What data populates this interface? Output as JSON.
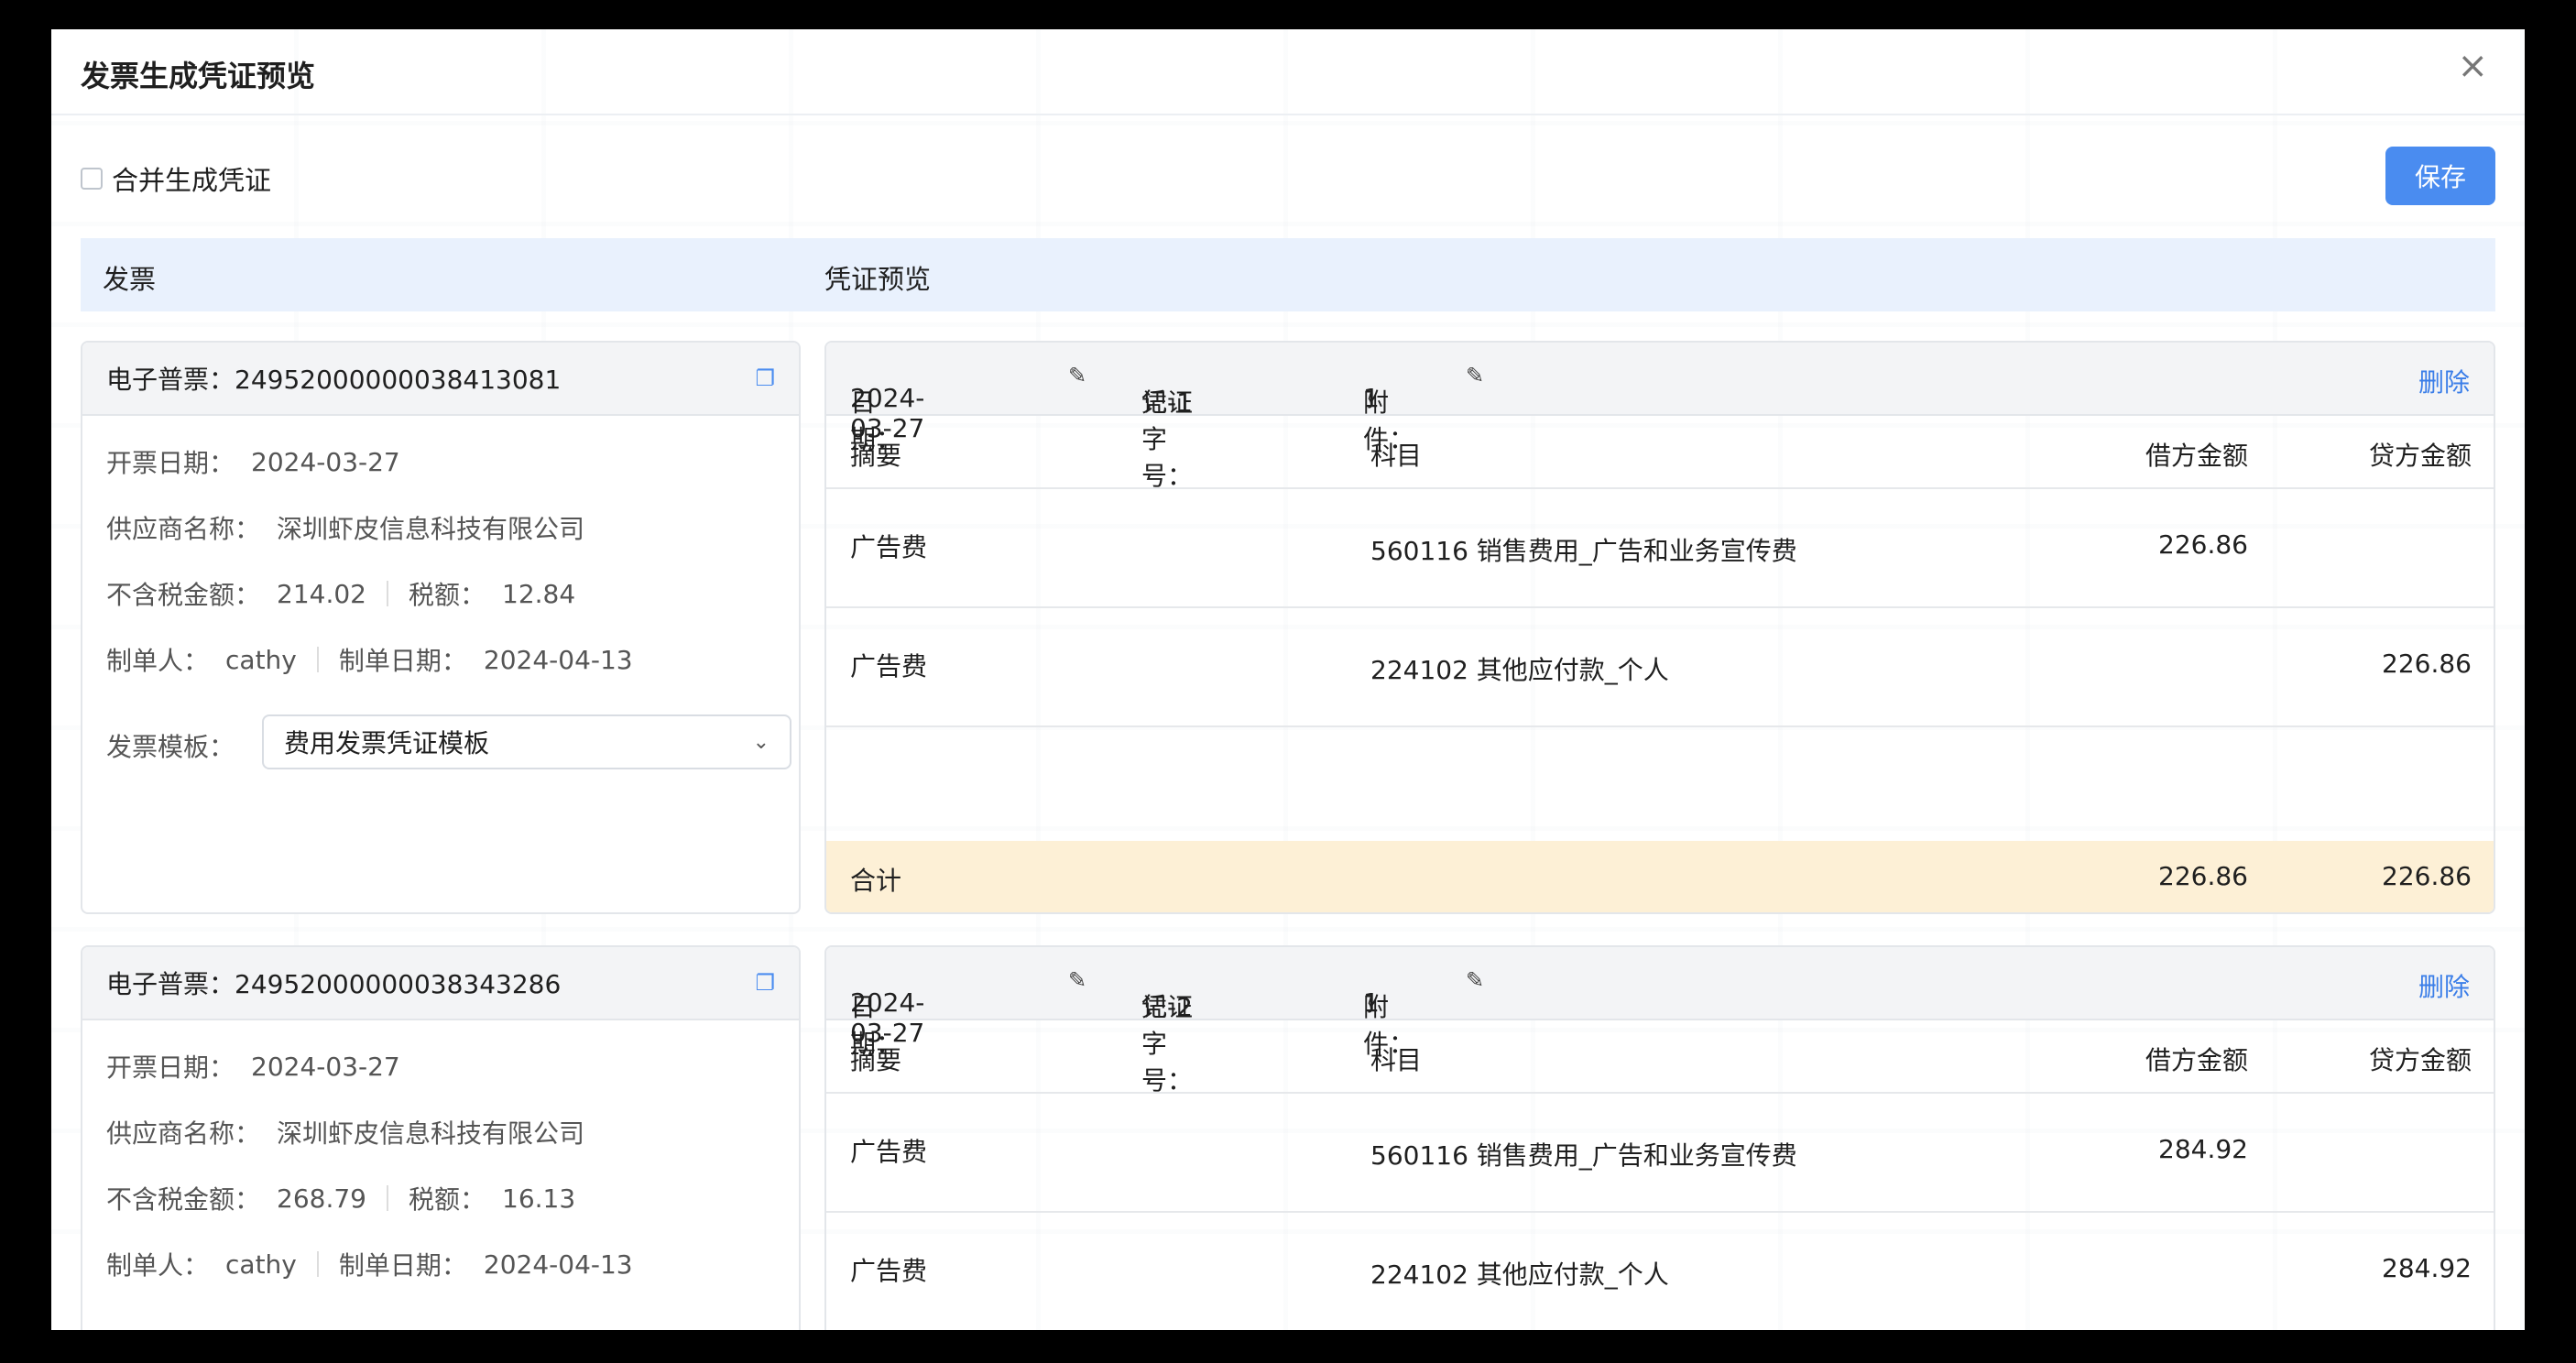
{
  "dialog": {
    "title": "发票生成凭证预览",
    "close": "×"
  },
  "toolbar": {
    "merge_label": "合并生成凭证",
    "save_label": "保存"
  },
  "columns": {
    "invoice": "发票",
    "voucher": "凭证预览"
  },
  "labels": {
    "invoice_prefix": "电子普票：",
    "issue_date": "开票日期：",
    "supplier": "供应商名称：",
    "amount_ex_tax": "不含税金额：",
    "tax": "税额：",
    "maker": "制单人：",
    "make_date": "制单日期：",
    "template": "发票模板：",
    "date": "日期：",
    "voucher_no": "凭证字号：",
    "attachments": "附件：",
    "delete": "删除",
    "col_summary": "摘要",
    "col_account": "科目",
    "col_debit": "借方金额",
    "col_credit": "贷方金额",
    "total": "合计"
  },
  "entries": [
    {
      "invoice": {
        "number": "24952000000038413081",
        "issue_date": "2024-03-27",
        "supplier": "深圳虾皮信息科技有限公司",
        "amount_ex_tax": "214.02",
        "tax": "12.84",
        "maker": "cathy",
        "make_date": "2024-04-13",
        "template": "费用发票凭证模板"
      },
      "voucher": {
        "date": "2024-03-27",
        "number": "记-1",
        "attachments": "1",
        "rows": [
          {
            "summary": "广告费",
            "account": "560116 销售费用_广告和业务宣传费",
            "debit": "226.86",
            "credit": ""
          },
          {
            "summary": "广告费",
            "account": "224102 其他应付款_个人",
            "debit": "",
            "credit": "226.86"
          }
        ],
        "total_debit": "226.86",
        "total_credit": "226.86"
      }
    },
    {
      "invoice": {
        "number": "24952000000038343286",
        "issue_date": "2024-03-27",
        "supplier": "深圳虾皮信息科技有限公司",
        "amount_ex_tax": "268.79",
        "tax": "16.13",
        "maker": "cathy",
        "make_date": "2024-04-13"
      },
      "voucher": {
        "date": "2024-03-27",
        "number": "记-2",
        "attachments": "1",
        "rows": [
          {
            "summary": "广告费",
            "account": "560116 销售费用_广告和业务宣传费",
            "debit": "284.92",
            "credit": ""
          },
          {
            "summary": "广告费",
            "account": "224102 其他应付款_个人",
            "debit": "",
            "credit": "284.92"
          }
        ]
      }
    }
  ],
  "icons": {
    "copy": "copy-icon",
    "edit": "pencil-icon",
    "close": "close-icon",
    "chevron": "chevron-down-icon"
  },
  "colors": {
    "primary": "#4a8cf0",
    "header_bg": "#e9f1fd",
    "total_bg": "#fdf0d6"
  }
}
